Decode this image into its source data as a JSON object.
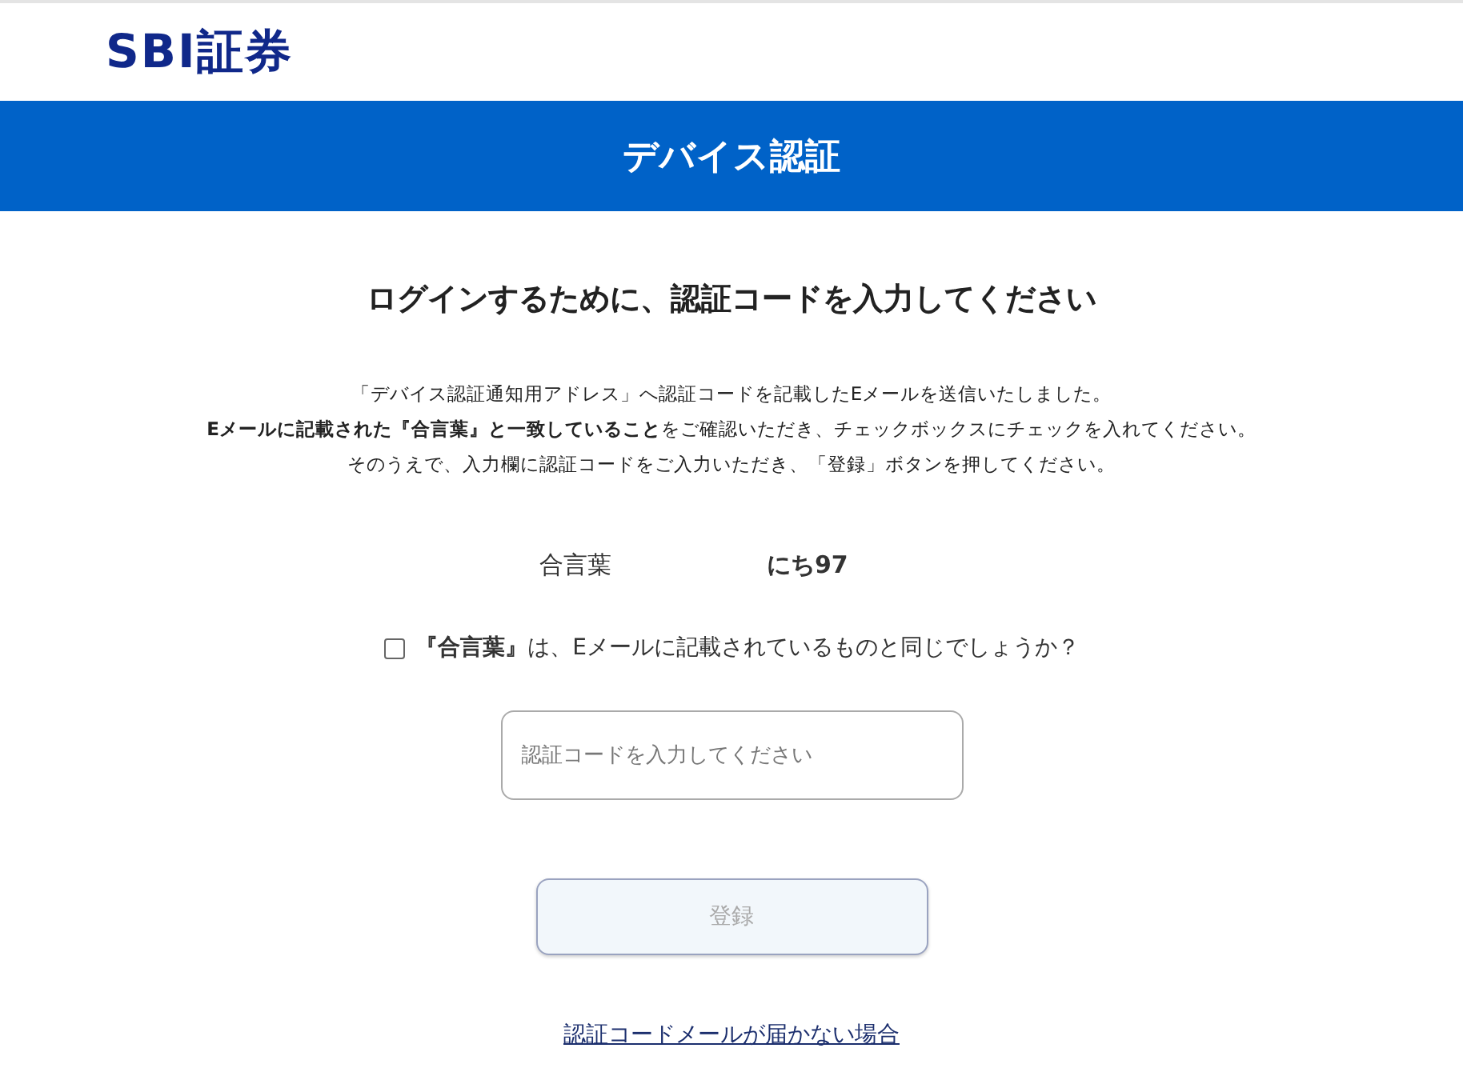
{
  "header": {
    "logo": "SBI証券"
  },
  "banner": {
    "title": "デバイス認証"
  },
  "heading": "ログインするために、認証コードを入力してください",
  "instructions": [
    "「デバイス認証通知用アドレス」へ認証コードを記載したEメールを送信いたしました。",
    "**Eメールに記載された『合言葉』と一致していること**をご確認いただき、チェックボックスにチェックを入れてください。",
    "そのうえで、入力欄に認証コードをご入力いただき、「登録」ボタンを押してください。"
  ],
  "passphrase": {
    "label": "合言葉",
    "value": "にち97"
  },
  "confirm": {
    "label": "**『合言葉』**は、Eメールに記載されているものと同じでしょうか？",
    "checked": false
  },
  "code_field": {
    "placeholder": "認証コードを入力してください"
  },
  "register_button": {
    "label": "登録",
    "disabled": true
  },
  "help_link": "認証コードメールが届かない場合"
}
